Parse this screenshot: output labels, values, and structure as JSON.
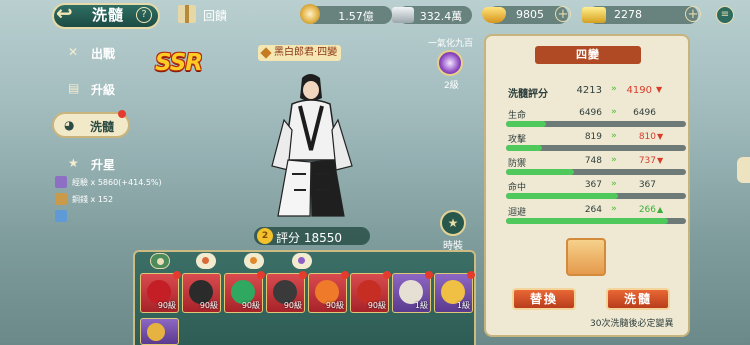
{
  "header": {
    "title": "洗髓",
    "help": "?",
    "gift_label": "回饋",
    "resources": [
      {
        "icon": "coin-icon",
        "value": "1.57億"
      },
      {
        "icon": "silver-ingot-icon",
        "value": "332.4萬"
      },
      {
        "icon": "gold-ingot-icon",
        "value": "9805"
      },
      {
        "icon": "gold-bar-icon",
        "value": "2278"
      }
    ]
  },
  "sidebar": {
    "items": [
      {
        "label": "出戰",
        "icon": "crossed-swords-icon"
      },
      {
        "label": "升級",
        "icon": "scroll-icon"
      },
      {
        "label": "洗髓",
        "icon": "cat-face-icon"
      },
      {
        "label": "升星",
        "icon": "star-icon"
      }
    ],
    "exp": [
      {
        "label": "經驗",
        "value": "x 5860(+414.5%)"
      },
      {
        "label": "銅錢",
        "value": "x 152"
      }
    ]
  },
  "hero": {
    "rarity": "SSR",
    "name": "黑白郎君·四變",
    "skill_title": "一氣化九百",
    "skill_level": "2級",
    "costume_label": "時裝",
    "score_label": "評分",
    "score_value": "18550"
  },
  "pets": {
    "tabs": [
      "all-tab",
      "paw-tab",
      "paw2-tab",
      "ball-tab"
    ],
    "slots": [
      {
        "name": "red-dragon",
        "level": "90級",
        "color": "#d9363a",
        "body": "#c41e26"
      },
      {
        "name": "black-white-hero",
        "level": "90級",
        "color": "#d9363a",
        "body": "#2b2b2b"
      },
      {
        "name": "green-dragon",
        "level": "90級",
        "color": "#d9363a",
        "body": "#2fa860"
      },
      {
        "name": "black-bird",
        "level": "90級",
        "color": "#d9363a",
        "body": "#3a3a3a"
      },
      {
        "name": "fox",
        "level": "90級",
        "color": "#d9363a",
        "body": "#ee7a2a"
      },
      {
        "name": "rooster",
        "level": "90級",
        "color": "#d9363a",
        "body": "#c72e23"
      },
      {
        "name": "white-tiger",
        "level": "1級",
        "color": "#d9363a",
        "body": "#e6e0d4"
      },
      {
        "name": "cat",
        "level": "1級",
        "color": "#d9363a",
        "body": "#f0c044"
      }
    ]
  },
  "panel": {
    "title": "四變",
    "eval_label": "洗髓評分",
    "eval_old": "4213",
    "eval_new": "4190",
    "stats": [
      {
        "label": "生命",
        "old": "6496",
        "new": "6496",
        "trend": "same",
        "fill": 0.22
      },
      {
        "label": "攻擊",
        "old": "819",
        "new": "810",
        "trend": "down",
        "fill": 0.2
      },
      {
        "label": "防禦",
        "old": "748",
        "new": "737",
        "trend": "down",
        "fill": 0.38
      },
      {
        "label": "命中",
        "old": "367",
        "new": "367",
        "trend": "same",
        "fill": 0.62
      },
      {
        "label": "迴避",
        "old": "264",
        "new": "266",
        "trend": "up",
        "fill": 0.9
      }
    ],
    "replace_button": "替換",
    "reroll_button": "洗髓",
    "hint": "30次洗髓後必定變異"
  }
}
